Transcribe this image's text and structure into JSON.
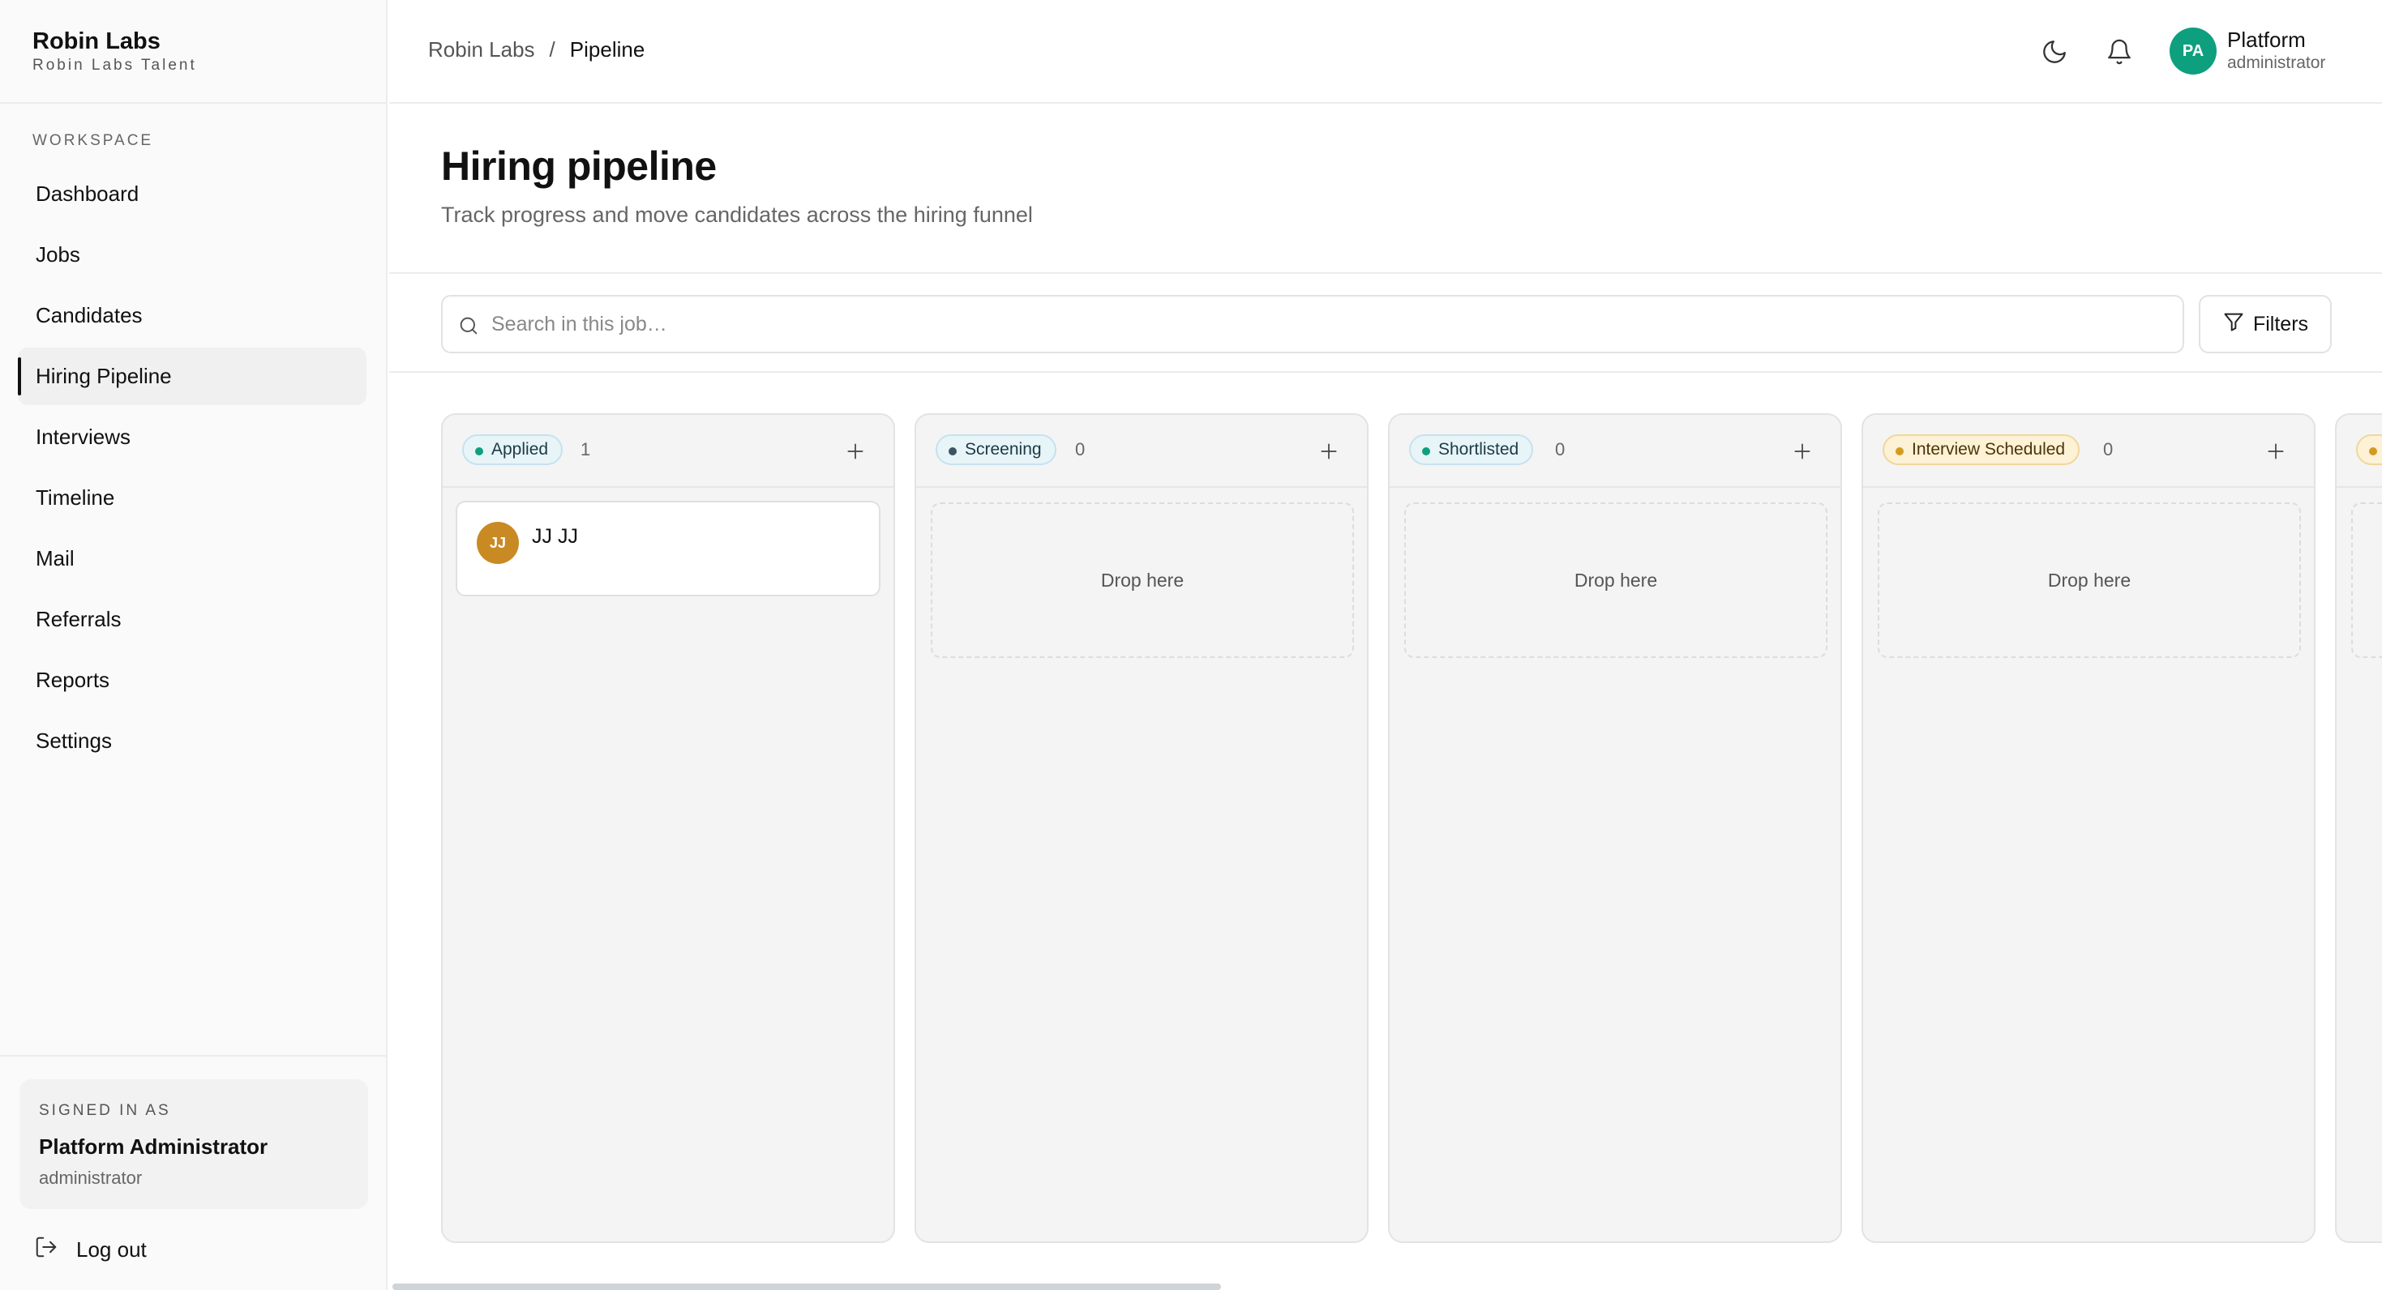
{
  "sidebar": {
    "brand_title": "Robin Labs",
    "brand_subtitle": "Robin Labs Talent",
    "section_label": "WORKSPACE",
    "items": [
      {
        "label": "Dashboard",
        "active": false
      },
      {
        "label": "Jobs",
        "active": false
      },
      {
        "label": "Candidates",
        "active": false
      },
      {
        "label": "Hiring Pipeline",
        "active": true
      },
      {
        "label": "Interviews",
        "active": false
      },
      {
        "label": "Timeline",
        "active": false
      },
      {
        "label": "Mail",
        "active": false
      },
      {
        "label": "Referrals",
        "active": false
      },
      {
        "label": "Reports",
        "active": false
      },
      {
        "label": "Settings",
        "active": false
      }
    ],
    "signed_in_label": "SIGNED IN AS",
    "signed_in_name": "Platform Administrator",
    "signed_in_role": "administrator",
    "logout_label": "Log out"
  },
  "topbar": {
    "breadcrumb_root": "Robin Labs",
    "breadcrumb_separator": "/",
    "breadcrumb_current": "Pipeline",
    "theme_icon": "moon-icon",
    "notifications_icon": "bell-icon",
    "user_initials": "PA",
    "user_name": "Platform",
    "user_role": "administrator"
  },
  "header": {
    "title": "Hiring pipeline",
    "subtitle": "Track progress and move candidates across the hiring funnel"
  },
  "toolbar": {
    "search_placeholder": "Search in this job…",
    "filters_label": "Filters"
  },
  "board": {
    "drop_label": "Drop here",
    "columns": [
      {
        "stage": "Applied",
        "count": "1",
        "color": "#0e9f7e",
        "cards": [
          {
            "initials": "JJ",
            "name": "JJ JJ",
            "avatar_color": "#c98a23"
          }
        ]
      },
      {
        "stage": "Screening",
        "count": "0",
        "color": "#3b5563",
        "cards": []
      },
      {
        "stage": "Shortlisted",
        "count": "0",
        "color": "#0e9f7e",
        "cards": []
      },
      {
        "stage": "Interview Scheduled",
        "count": "0",
        "color": "#d39b1f",
        "cards": []
      }
    ]
  },
  "colors": {
    "accent": "#0e9f7e",
    "amber": "#d39b1f"
  }
}
